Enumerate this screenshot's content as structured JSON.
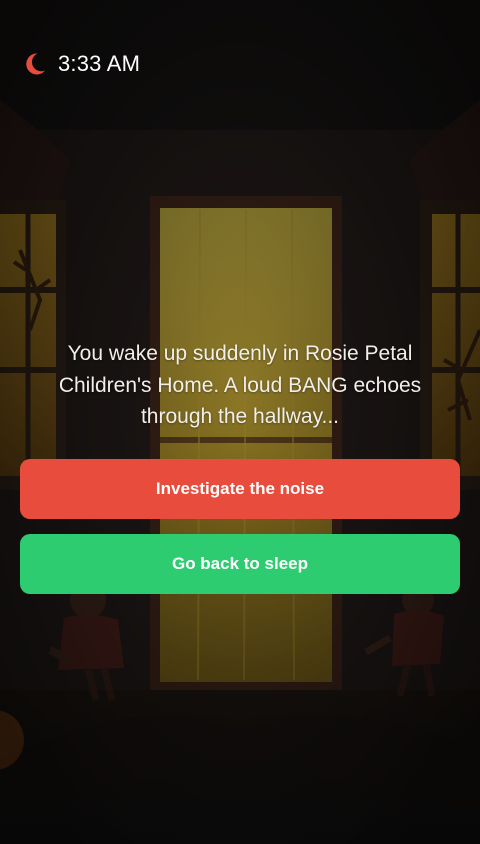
{
  "status": {
    "time": "3:33 AM",
    "icon": "moon-icon",
    "icon_color": "#e74c3c"
  },
  "story": {
    "text": "You wake up suddenly in Rosie Petal Children's Home. A loud BANG echoes through the hallway..."
  },
  "choices": [
    {
      "label": "Investigate the noise",
      "color": "#e74c3c"
    },
    {
      "label": "Go back to sleep",
      "color": "#2ecc71"
    }
  ],
  "colors": {
    "background": "#19191a",
    "window_glow": "#d9b43a"
  }
}
